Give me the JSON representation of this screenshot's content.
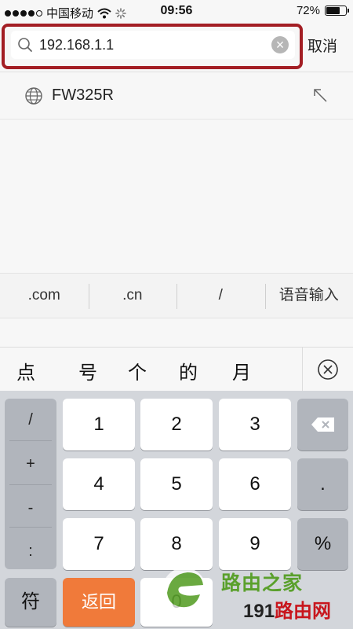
{
  "status_bar": {
    "carrier": "中国移动",
    "time": "09:56",
    "battery": "72%",
    "battery_level": 0.72
  },
  "search": {
    "value": "192.168.1.1",
    "cancel_label": "取消"
  },
  "suggestion": {
    "label": "FW325R"
  },
  "quick_bar": [
    ".com",
    ".cn",
    "/",
    "语音输入"
  ],
  "candidates": [
    "点",
    "号",
    "个",
    "的",
    "月"
  ],
  "keyboard": {
    "symbols": [
      "/",
      "+",
      "-",
      ":"
    ],
    "digits": [
      "1",
      "2",
      "3",
      "4",
      "5",
      "6",
      "7",
      "8",
      "9",
      "0"
    ],
    "dot_key": ".",
    "percent_key": "%",
    "symbol_switch": "符",
    "back_key": "返回"
  },
  "watermark": {
    "line1": "路由之家",
    "line2_prefix": "191",
    "line2_suffix": "路由网"
  },
  "colors": {
    "highlight_border": "#a31e24",
    "back_key": "#f07a3a",
    "watermark_green": "#5aa02c",
    "watermark_red": "#c8161d"
  }
}
